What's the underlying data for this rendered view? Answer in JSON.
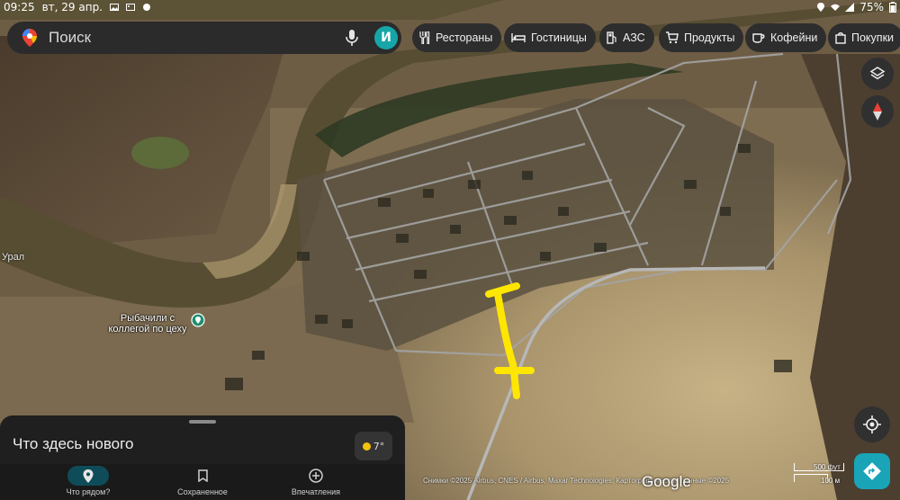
{
  "status_bar": {
    "time": "09:25",
    "date": "вт, 29 апр.",
    "battery": "75%"
  },
  "search": {
    "placeholder": "Поиск",
    "avatar_letter": "И"
  },
  "chips": [
    {
      "label": "Рестораны",
      "icon": "restaurant-icon"
    },
    {
      "label": "Гостиницы",
      "icon": "hotel-icon"
    },
    {
      "label": "АЗС",
      "icon": "gas-station-icon"
    },
    {
      "label": "Продукты",
      "icon": "shopping-cart-icon"
    },
    {
      "label": "Кофейни",
      "icon": "coffee-icon"
    },
    {
      "label": "Покупки",
      "icon": "shopping-bag-icon"
    }
  ],
  "map": {
    "river_label": "Урал",
    "place_label_line1": "Рыбачили с",
    "place_label_line2": "коллегой по цеху",
    "colors": {
      "river": "#5a5334",
      "sand": "#b9a277",
      "road": "#a9a9a9",
      "marker": "#ffe600"
    }
  },
  "sheet": {
    "title": "Что здесь нового",
    "weather": "7°"
  },
  "nav": [
    {
      "label": "Что рядом?",
      "icon": "location-pin-icon",
      "active": true
    },
    {
      "label": "Сохраненное",
      "icon": "bookmark-icon",
      "active": false
    },
    {
      "label": "Впечатления",
      "icon": "add-circle-icon",
      "active": false
    }
  ],
  "attribution": {
    "text": "Снимки ©2025 Airbus, CNES / Airbus, Maxar Technologies, Картографические данные ©2025",
    "logo": "Google",
    "scale_top": "500 фут",
    "scale_bottom": "100 м"
  }
}
